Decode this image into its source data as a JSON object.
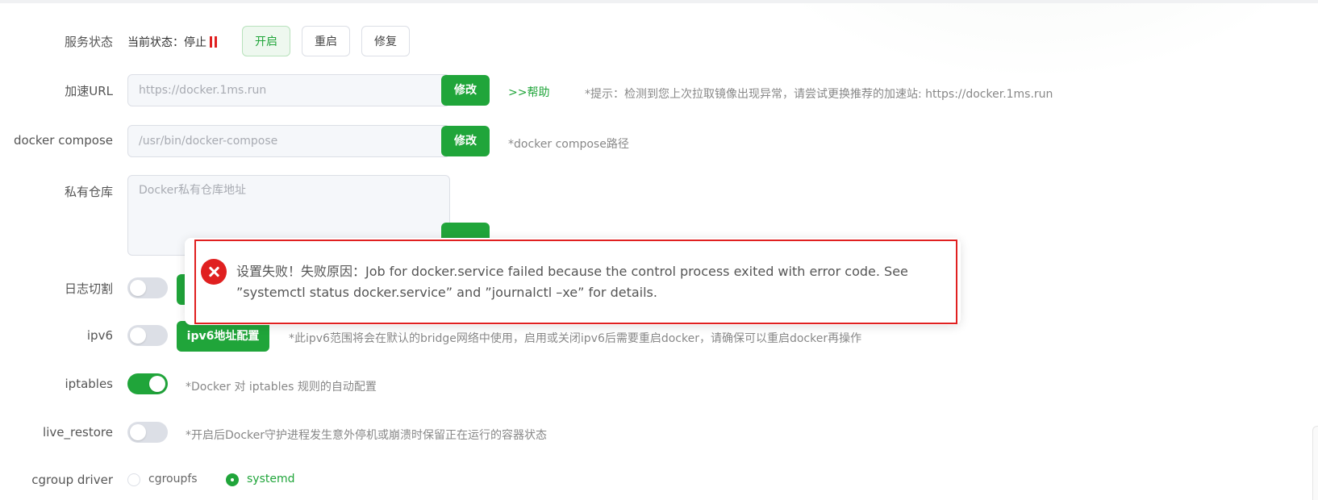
{
  "service_status": {
    "label": "服务状态",
    "current_state_text": "当前状态：停止",
    "buttons": {
      "start": "开启",
      "restart": "重启",
      "repair": "修复"
    }
  },
  "accel_url": {
    "label": "加速URL",
    "placeholder": "https://docker.1ms.run",
    "modify_label": "修改",
    "help_link": ">>帮助",
    "hint": "*提示：检测到您上次拉取镜像出现异常，请尝试更换推荐的加速站: https://docker.1ms.run"
  },
  "docker_compose": {
    "label": "docker compose",
    "placeholder": "/usr/bin/docker-compose",
    "modify_label": "修改",
    "hint": "*docker compose路径"
  },
  "private_registry": {
    "label": "私有仓库",
    "placeholder": "Docker私有仓库地址"
  },
  "log_rotate": {
    "label": "日志切割",
    "enabled": false
  },
  "ipv6": {
    "label": "ipv6",
    "enabled": false,
    "config_button": "ipv6地址配置",
    "hint": "*此ipv6范围将会在默认的bridge网络中使用，启用或关闭ipv6后需要重启docker，请确保可以重启docker再操作"
  },
  "iptables": {
    "label": "iptables",
    "enabled": true,
    "hint": "*Docker 对 iptables 规则的自动配置"
  },
  "live_restore": {
    "label": "live_restore",
    "enabled": false,
    "hint": "*开启后Docker守护进程发生意外停机或崩溃时保留正在运行的容器状态"
  },
  "cgroup_driver": {
    "label": "cgroup driver",
    "options": [
      "cgroupfs",
      "systemd"
    ],
    "selected": "systemd"
  },
  "error_toast": {
    "message_line1": "设置失败！失败原因：Job for docker.service failed because the control process exited with error code. See",
    "message_line2": "”systemctl status docker.service” and ”journalctl –xe” for details."
  },
  "colors": {
    "accent": "#20a53a",
    "error": "#e02020",
    "input_bg": "#f5f7fa",
    "border": "#dcdfe6"
  }
}
